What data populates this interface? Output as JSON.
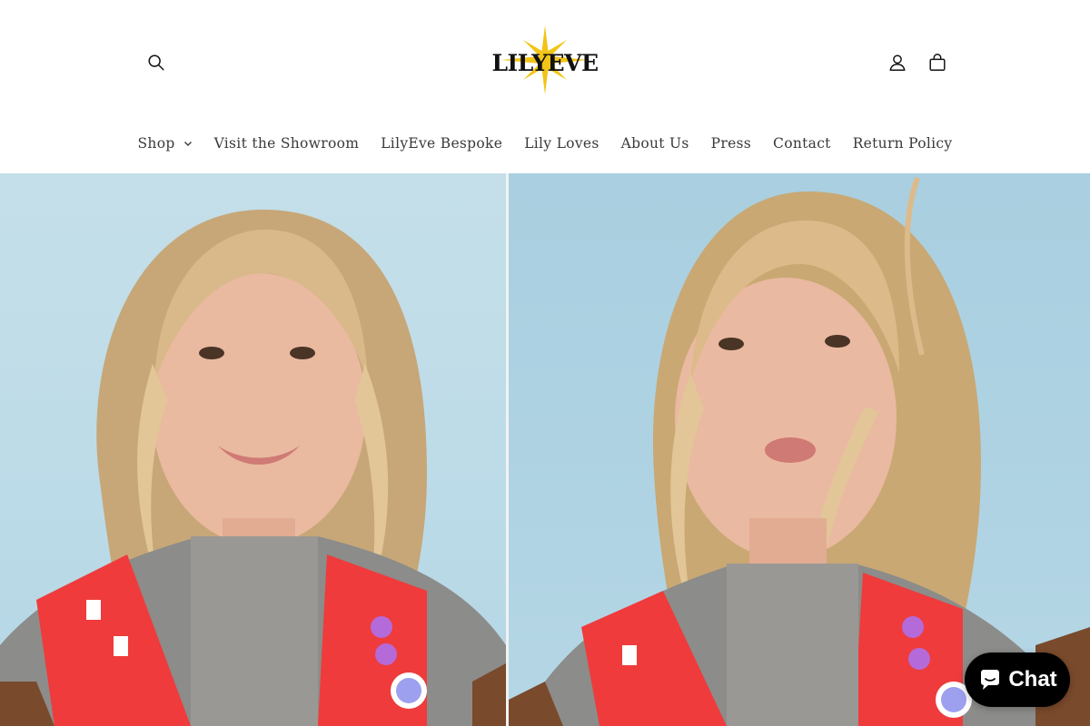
{
  "header": {
    "logo_text": "LILYEVE",
    "icons": {
      "search": "search-icon",
      "account": "account-icon",
      "cart": "cart-icon"
    }
  },
  "nav": {
    "items": [
      {
        "label": "Shop",
        "has_dropdown": true
      },
      {
        "label": "Visit the Showroom"
      },
      {
        "label": "LilyEve Bespoke"
      },
      {
        "label": "Lily Loves"
      },
      {
        "label": "About Us"
      },
      {
        "label": "Press"
      },
      {
        "label": "Contact"
      },
      {
        "label": "Return Policy"
      }
    ]
  },
  "chat": {
    "label": "Chat",
    "icon": "chat-bubble-icon"
  },
  "colors": {
    "logo_star": "#f2c418",
    "sky_left": "#c4dfe9",
    "sky_right": "#a9cfe0",
    "chat_bg": "#000000"
  }
}
